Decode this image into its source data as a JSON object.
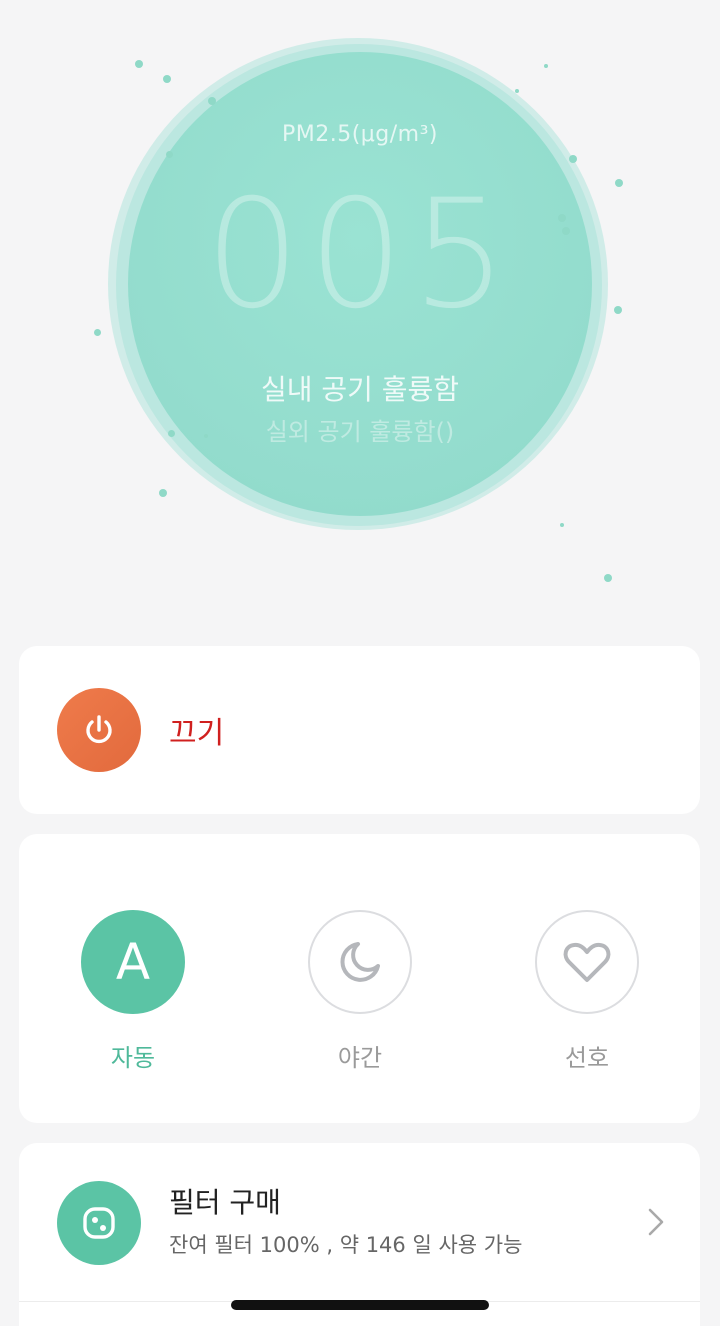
{
  "air": {
    "pm_label": "PM2.5(μg/m³)",
    "pm_value": "005",
    "indoor_status": "실내 공기 훌륭함",
    "outdoor_status": "실외 공기 훌륭함()"
  },
  "power": {
    "label": "끄기",
    "icon": "power-icon"
  },
  "modes": [
    {
      "label": "자동",
      "icon": "auto-a-icon",
      "glyph": "A",
      "selected": true
    },
    {
      "label": "야간",
      "icon": "moon-icon",
      "selected": false
    },
    {
      "label": "선호",
      "icon": "heart-icon",
      "selected": false
    }
  ],
  "filter": {
    "title": "필터 구매",
    "subtitle": "잔여 필터 100% , 약 146 일 사용 가능",
    "icon": "filter-icon"
  },
  "colors": {
    "accent": "#5bc4a5",
    "power": "#e8703f",
    "power_label": "#d0201f",
    "halo": "#9ae3d3"
  }
}
